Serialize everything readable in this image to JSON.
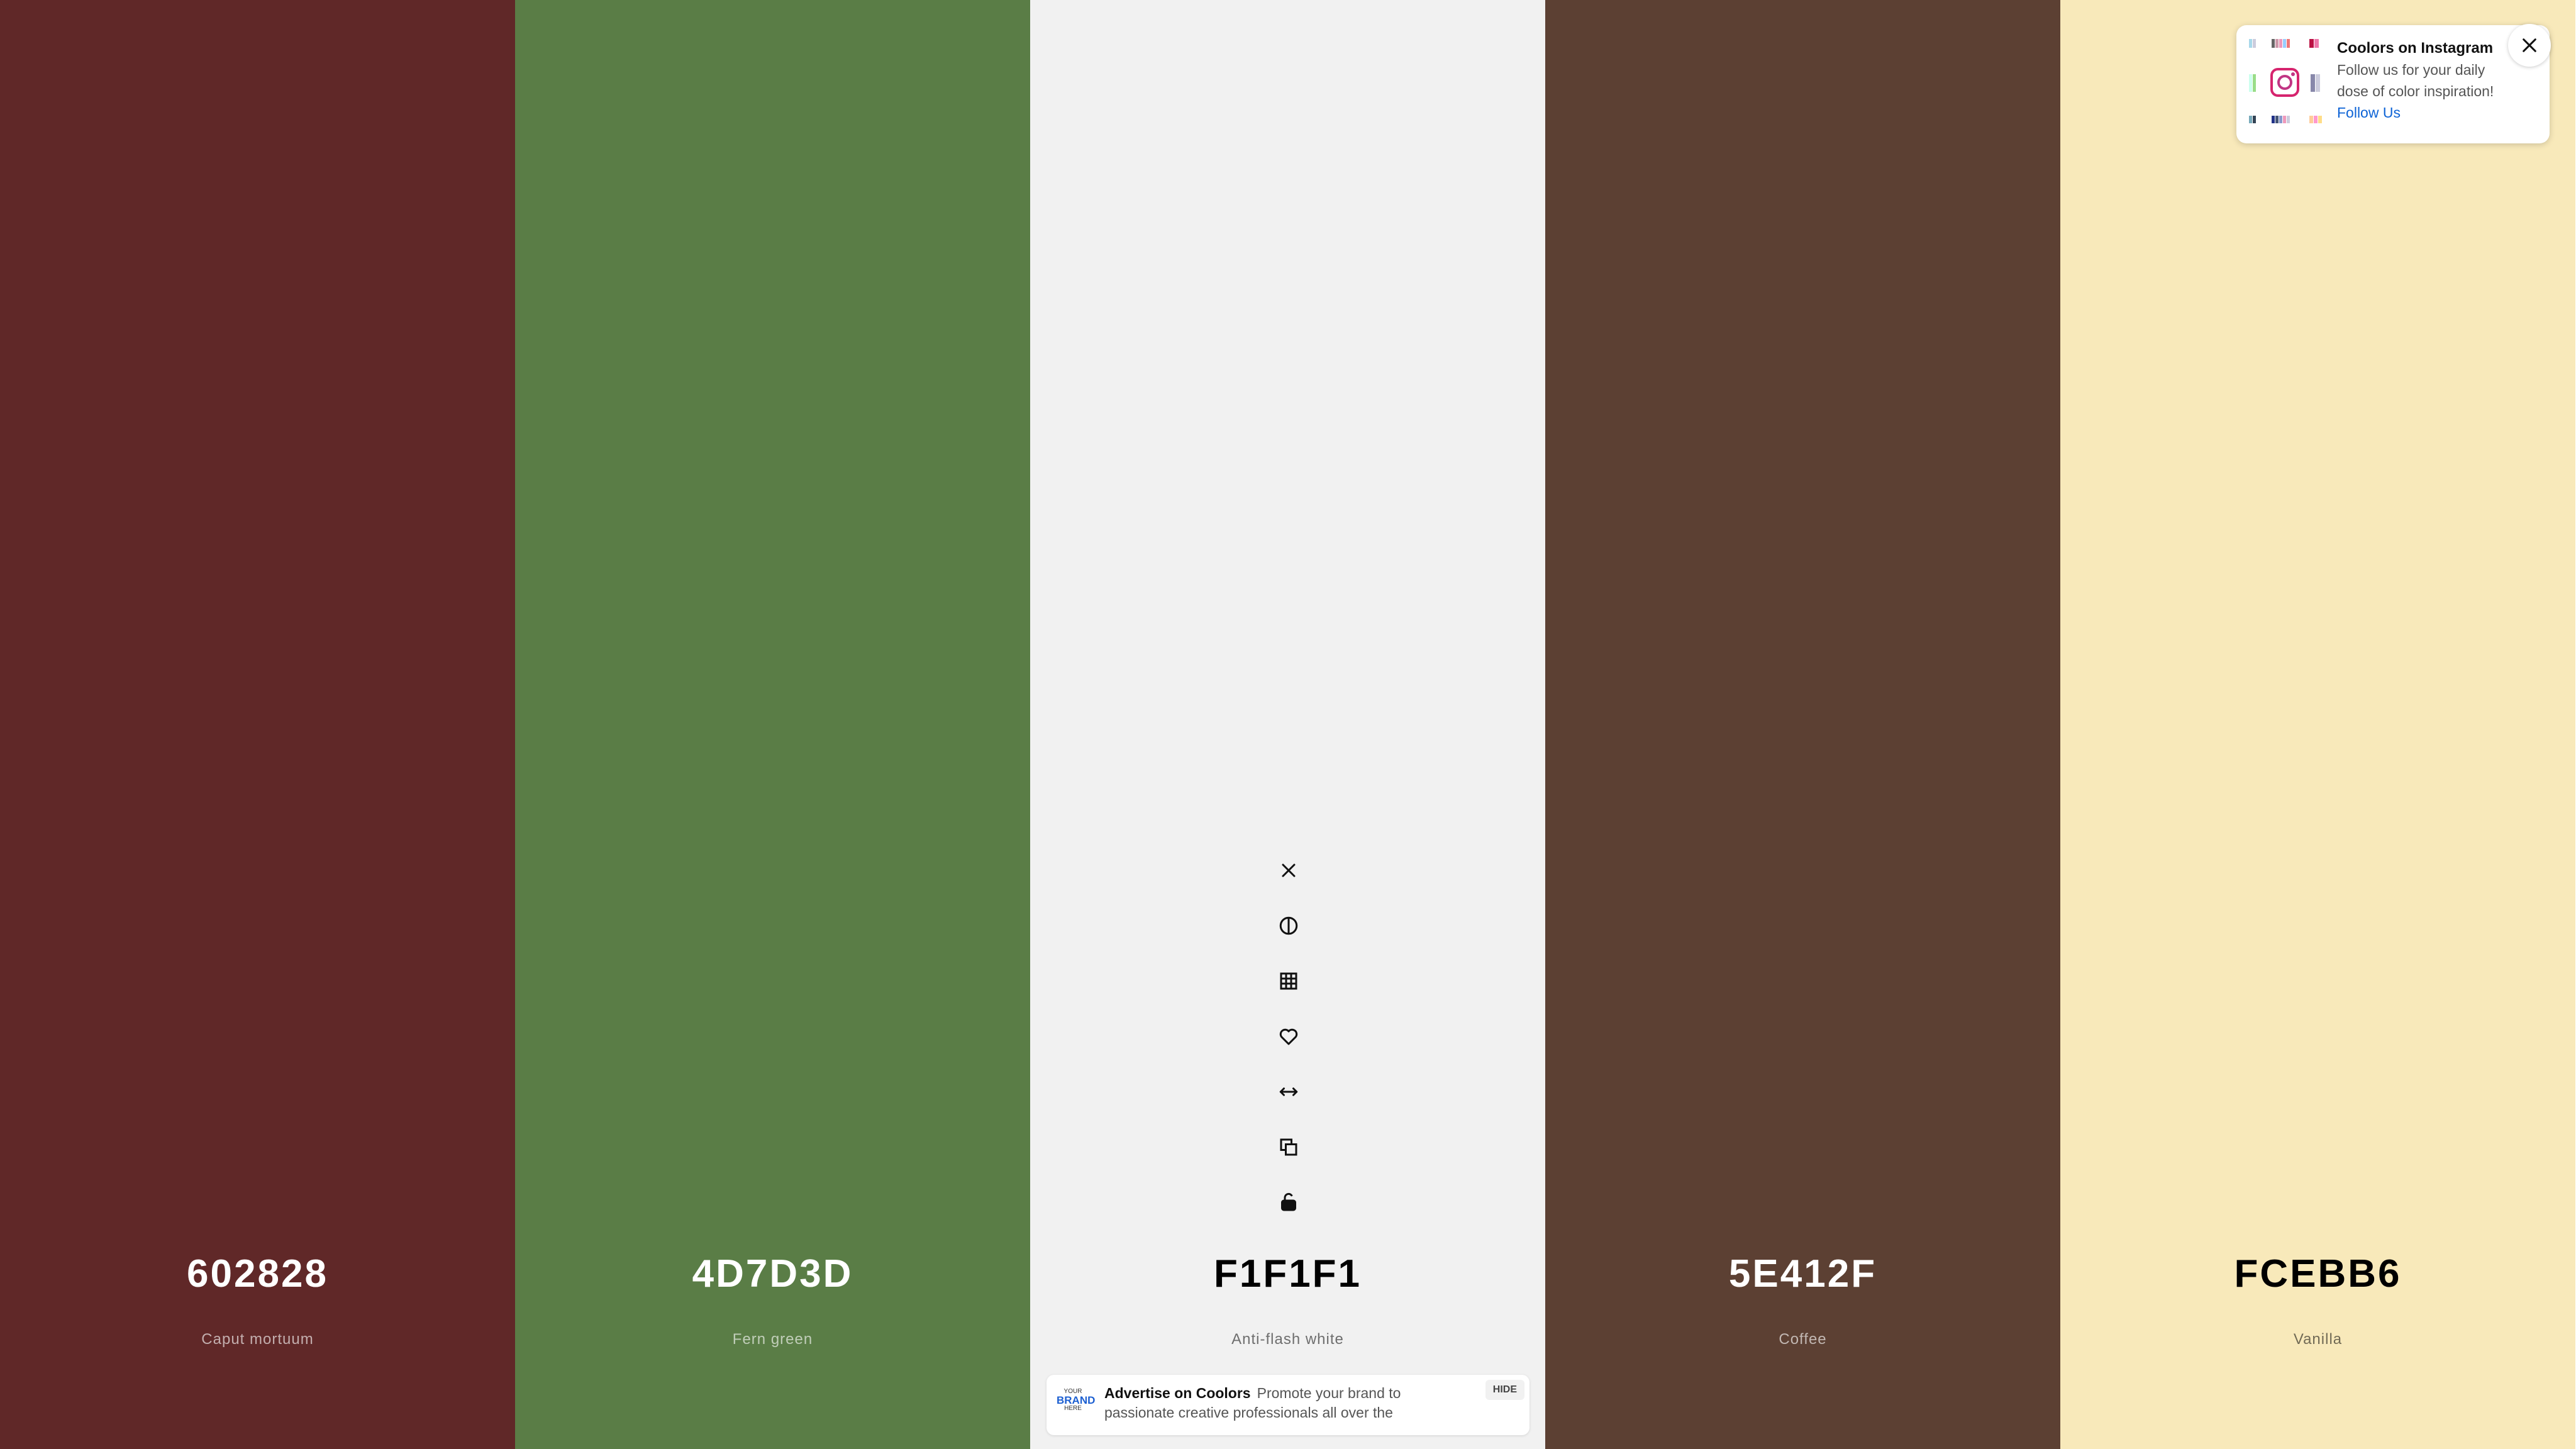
{
  "palette": [
    {
      "hex": "602828",
      "name": "Caput mortuum",
      "bg": "#602828",
      "width_frac": 0.2,
      "tone": "dark"
    },
    {
      "hex": "4D7D3D",
      "name": "Fern green",
      "bg": "#5a7d46",
      "width_frac": 0.2,
      "tone": "dark"
    },
    {
      "hex": "F1F1F1",
      "name": "Anti-flash white",
      "bg": "#F1F1F1",
      "width_frac": 0.2,
      "tone": "light"
    },
    {
      "hex": "5E412F",
      "name": "Coffee",
      "bg": "#5C4033",
      "width_frac": 0.2,
      "tone": "dark"
    },
    {
      "hex": "FCEBB6",
      "name": "Vanilla",
      "bg": "#F8E9BA",
      "width_frac": 0.2,
      "tone": "light"
    }
  ],
  "tools": [
    {
      "name": "remove-color-button",
      "icon": "close-icon"
    },
    {
      "name": "shades-button",
      "icon": "contrast-icon"
    },
    {
      "name": "view-shades-button",
      "icon": "grid-icon"
    },
    {
      "name": "save-color-button",
      "icon": "heart-icon"
    },
    {
      "name": "drag-button",
      "icon": "arrows-horizontal-icon"
    },
    {
      "name": "copy-hex-button",
      "icon": "copy-icon"
    },
    {
      "name": "lock-button",
      "icon": "unlock-icon"
    }
  ],
  "instagram_popup": {
    "title": "Coolors on Instagram",
    "description": "Follow us for your daily dose of color inspiration!",
    "link": "Follow Us"
  },
  "ad": {
    "logo_lines": [
      "YOUR",
      "BRAND",
      "HERE"
    ],
    "title": "Advertise on Coolors",
    "text": "Promote your brand to passionate creative professionals all over the",
    "hide_label": "HIDE"
  }
}
